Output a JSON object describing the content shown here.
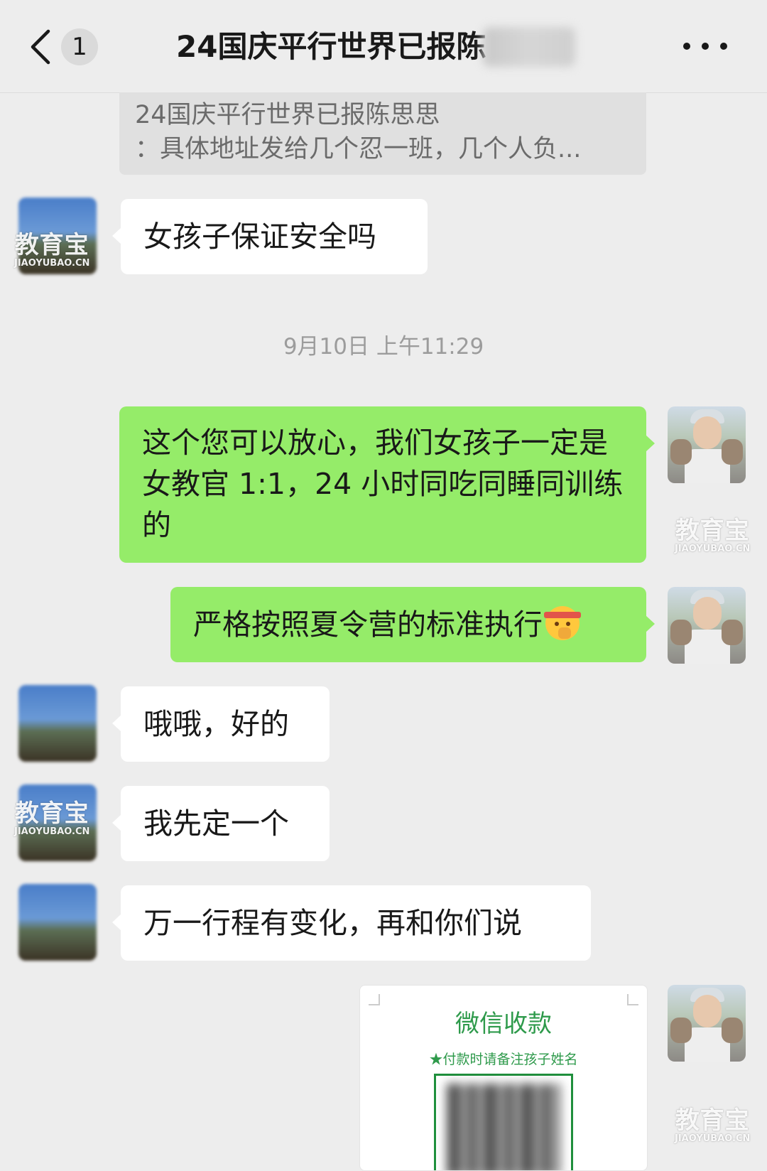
{
  "header": {
    "unread_count": "1",
    "title": "24国庆平行世界已报陈",
    "back_icon": "chevron-left-icon",
    "more_icon": "ellipsis-icon"
  },
  "quoted_message": {
    "line1": "24国庆平行世界已报陈思思",
    "line2": "：具体地址发给几个忍一班，几个人负..."
  },
  "watermark": {
    "cn": "教育宝",
    "en": "JIAOYUBAO.CN"
  },
  "messages": {
    "m1": "女孩子保证安全吗",
    "timestamp": "9月10日 上午11:29",
    "m2": "这个您可以放心，我们女孩子一定是女教官 1:1，24 小时同吃同睡同训练的",
    "m3": "严格按照夏令营的标准执行",
    "m4": "哦哦，好的",
    "m5": "我先定一个",
    "m6": "万一行程有变化，再和你们说"
  },
  "payment_card": {
    "title": "微信收款",
    "subtitle": "★付款时请备注孩子姓名"
  },
  "colors": {
    "background": "#ededed",
    "self_bubble": "#95ec69",
    "other_bubble": "#ffffff",
    "card_green": "#2e9a4b"
  }
}
